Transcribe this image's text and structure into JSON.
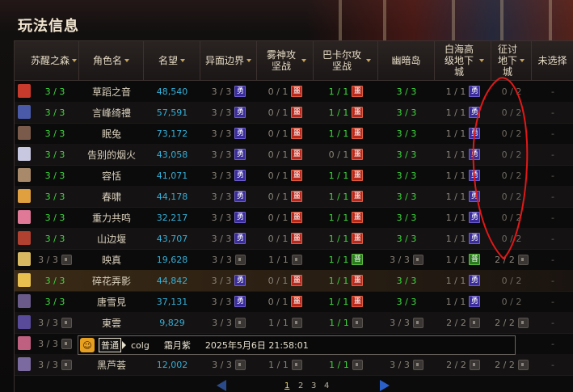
{
  "window": {
    "title": "玩法信息"
  },
  "columns": [
    {
      "label": "苏醒之森",
      "sortable": true
    },
    {
      "label": "角色名",
      "sortable": true
    },
    {
      "label": "名望",
      "sortable": true
    },
    {
      "label": "异面边界",
      "sortable": true
    },
    {
      "label": "雾神攻坚战",
      "sortable": true
    },
    {
      "label": "巴卡尔攻坚战",
      "sortable": true
    },
    {
      "label": "幽暗岛",
      "sortable": false
    },
    {
      "label": "白海高级地下城",
      "sortable": true
    },
    {
      "label": "征讨地下城",
      "sortable": true
    },
    {
      "label": "未选择",
      "sortable": false
    }
  ],
  "badges": {
    "hero": "勇",
    "nightmare": "噩",
    "normal": "普"
  },
  "rows": [
    {
      "name": "草蹈之音",
      "fame": "48,540",
      "forest": "3 / 3",
      "boundary": "3 / 3",
      "mist": "0 / 1",
      "bakal": "1 / 1",
      "dark_isle": "3 / 3",
      "white_sea": "1 / 1",
      "conquest": "0 / 2",
      "unselected": "-",
      "avatar": "#c83a2c",
      "locked": false
    },
    {
      "name": "言峰绮禮",
      "fame": "57,591",
      "forest": "3 / 3",
      "boundary": "3 / 3",
      "mist": "0 / 1",
      "bakal": "1 / 1",
      "dark_isle": "3 / 3",
      "white_sea": "1 / 1",
      "conquest": "0 / 2",
      "unselected": "-",
      "avatar": "#4a5aa8",
      "locked": false
    },
    {
      "name": "眠兔",
      "fame": "73,172",
      "forest": "3 / 3",
      "boundary": "3 / 3",
      "mist": "0 / 1",
      "bakal": "1 / 1",
      "dark_isle": "3 / 3",
      "white_sea": "1 / 1",
      "conquest": "0 / 2",
      "unselected": "-",
      "avatar": "#7a5a4a",
      "locked": false
    },
    {
      "name": "告别的烟火",
      "fame": "43,058",
      "forest": "3 / 3",
      "boundary": "3 / 3",
      "mist": "0 / 1",
      "bakal": "0 / 1",
      "dark_isle": "3 / 3",
      "white_sea": "1 / 1",
      "conquest": "0 / 2",
      "unselected": "-",
      "avatar": "#c8c8e0",
      "locked": false
    },
    {
      "name": "容恬",
      "fame": "41,071",
      "forest": "3 / 3",
      "boundary": "3 / 3",
      "mist": "0 / 1",
      "bakal": "1 / 1",
      "dark_isle": "3 / 3",
      "white_sea": "1 / 1",
      "conquest": "0 / 2",
      "unselected": "-",
      "avatar": "#a88a6a",
      "locked": false
    },
    {
      "name": "春啸",
      "fame": "44,178",
      "forest": "3 / 3",
      "boundary": "3 / 3",
      "mist": "0 / 1",
      "bakal": "1 / 1",
      "dark_isle": "3 / 3",
      "white_sea": "1 / 1",
      "conquest": "0 / 2",
      "unselected": "-",
      "avatar": "#e0a040",
      "locked": false
    },
    {
      "name": "重力共鸣",
      "fame": "32,217",
      "forest": "3 / 3",
      "boundary": "3 / 3",
      "mist": "0 / 1",
      "bakal": "1 / 1",
      "dark_isle": "3 / 3",
      "white_sea": "1 / 1",
      "conquest": "0 / 2",
      "unselected": "-",
      "avatar": "#e07898",
      "locked": false
    },
    {
      "name": "山边堰",
      "fame": "43,707",
      "forest": "3 / 3",
      "boundary": "3 / 3",
      "mist": "0 / 1",
      "bakal": "1 / 1",
      "dark_isle": "3 / 3",
      "white_sea": "1 / 1",
      "conquest": "0 / 2",
      "unselected": "-",
      "avatar": "#b04030",
      "locked": false
    },
    {
      "name": "映真",
      "fame": "19,628",
      "forest": "3 / 3",
      "boundary": "3 / 3",
      "mist": "1 / 1",
      "bakal": "1 / 1",
      "dark_isle": "3 / 3",
      "white_sea": "1 / 1",
      "conquest": "2 / 2",
      "unselected": "-",
      "avatar": "#d8b860",
      "locked": true
    },
    {
      "name": "碎花弄影",
      "fame": "44,842",
      "forest": "3 / 3",
      "boundary": "3 / 3",
      "mist": "0 / 1",
      "bakal": "1 / 1",
      "dark_isle": "3 / 3",
      "white_sea": "1 / 1",
      "conquest": "0 / 2",
      "unselected": "-",
      "avatar": "#e8c050",
      "locked": false
    },
    {
      "name": "唐雪見",
      "fame": "37,131",
      "forest": "3 / 3",
      "boundary": "3 / 3",
      "mist": "0 / 1",
      "bakal": "1 / 1",
      "dark_isle": "3 / 3",
      "white_sea": "1 / 1",
      "conquest": "0 / 2",
      "unselected": "-",
      "avatar": "#6a5a8a",
      "locked": false
    },
    {
      "name": "東雲",
      "fame": "9,829",
      "forest": "3 / 3",
      "boundary": "3 / 3",
      "mist": "1 / 1",
      "bakal": "1 / 1",
      "dark_isle": "3 / 3",
      "white_sea": "2 / 2",
      "conquest": "2 / 2",
      "unselected": "-",
      "avatar": "#5a4a9a",
      "locked": true
    },
    {
      "name": "",
      "fame": "",
      "forest": "3 / 3",
      "boundary": "",
      "mist": "",
      "bakal": "",
      "dark_isle": "",
      "white_sea": "",
      "conquest": "",
      "unselected": "-",
      "avatar": "#c06080",
      "locked": true
    },
    {
      "name": "黑芦荟",
      "fame": "12,002",
      "forest": "3 / 3",
      "boundary": "3 / 3",
      "mist": "1 / 1",
      "bakal": "1 / 1",
      "dark_isle": "3 / 3",
      "white_sea": "2 / 2",
      "conquest": "2 / 2",
      "unselected": "-",
      "avatar": "#7a6aa0",
      "locked": true
    }
  ],
  "tooltip": {
    "channel": "普通",
    "prefix": "colg",
    "username": "霜月紫",
    "datetime": "2025年5月6日 21:58:01"
  },
  "pagination": {
    "pages": [
      "1",
      "2",
      "3",
      "4"
    ],
    "current": "1"
  },
  "colors": {
    "green": "#3ddc3d",
    "fame": "#34b0d8",
    "annotation": "#e01818"
  }
}
